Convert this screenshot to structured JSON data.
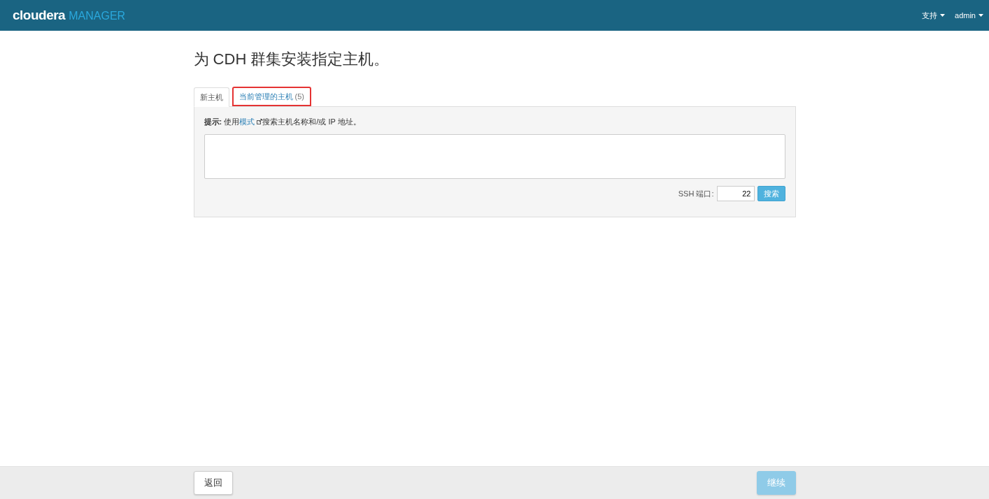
{
  "header": {
    "logo_main": "cloudera",
    "logo_sub": "MANAGER",
    "menus": [
      {
        "label": "支持"
      },
      {
        "label": "admin"
      }
    ]
  },
  "page_title": "为 CDH 群集安装指定主机。",
  "tabs": [
    {
      "label": "新主机",
      "selected": true,
      "highlighted": false
    },
    {
      "label": "当前管理的主机",
      "count": "(5)",
      "selected": false,
      "highlighted": true
    }
  ],
  "hint": {
    "prefix": "**提示:** 使用",
    "link": "模式",
    "suffix": "搜索主机名称和/或 IP 地址。"
  },
  "ssh_port": {
    "label": "SSH 端口:",
    "value": "22"
  },
  "search_button": "搜索",
  "footer": {
    "back_button": {
      "label": "返回",
      "disabled": false
    },
    "continue_button": {
      "label": "继续",
      "disabled": true
    }
  }
}
